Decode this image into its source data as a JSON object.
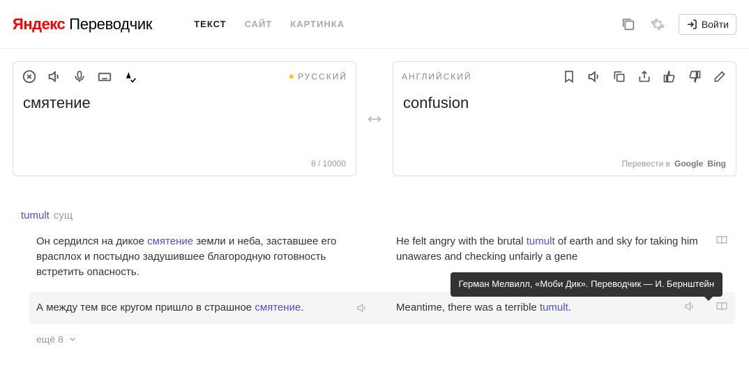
{
  "header": {
    "logo_red": "Яндекс",
    "logo_rest": "Переводчик",
    "tabs": {
      "text": "ТЕКСТ",
      "site": "САЙТ",
      "image": "КАРТИНКА"
    },
    "login": "Войти"
  },
  "source": {
    "lang": "РУССКИЙ",
    "text": "смятение",
    "counter": "8 / 10000"
  },
  "target": {
    "lang": "АНГЛИЙСКИЙ",
    "text": "confusion",
    "translate_in": "Перевести в",
    "google": "Google",
    "bing": "Bing"
  },
  "dict": {
    "word": "tumult",
    "pos": "сущ",
    "more": "ещё 8",
    "examples": [
      {
        "ru_pre": "Он сердился на дикое ",
        "ru_hl": "смятение",
        "ru_post": " земли и неба, заставшее его врасплох и постыдно задушившее благородную готовность встретить опасность.",
        "en_pre": "He felt angry with the brutal ",
        "en_hl": "tumult",
        "en_post": " of earth and sky for taking him unawares and checking unfairly a gene"
      },
      {
        "ru_pre": "А между тем все кругом пришло в страшное ",
        "ru_hl": "смятение",
        "ru_post": ".",
        "en_pre": "Meantime, there was a terrible ",
        "en_hl": "tumult",
        "en_post": "."
      }
    ],
    "tooltip": "Герман Мелвилл, «Моби Дик». Переводчик — И. Бернштейн"
  }
}
